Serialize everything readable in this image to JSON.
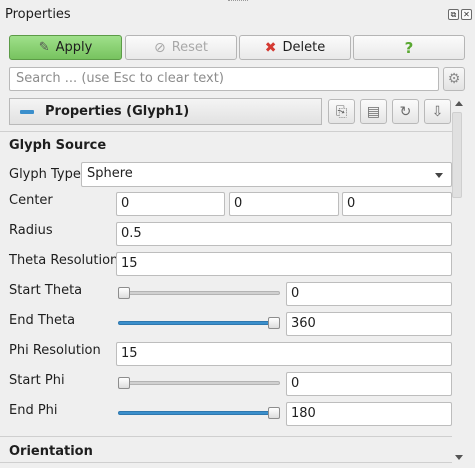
{
  "window": {
    "title": "Properties"
  },
  "toolbar": {
    "apply_label": "Apply",
    "reset_label": "Reset",
    "delete_label": "Delete",
    "help_label": "?"
  },
  "search": {
    "placeholder": "Search ... (use Esc to clear text)"
  },
  "panel": {
    "title": "Properties (Glyph1)"
  },
  "glyph_source": {
    "section_title": "Glyph Source",
    "glyph_type_label": "Glyph Type",
    "glyph_type_value": "Sphere",
    "center_label": "Center",
    "center_values": [
      "0",
      "0",
      "0"
    ],
    "radius_label": "Radius",
    "radius_value": "0.5",
    "theta_resolution_label": "Theta Resolution",
    "theta_resolution_value": "15",
    "start_theta_label": "Start Theta",
    "start_theta_value": "0",
    "start_theta_level": 0.0,
    "end_theta_label": "End Theta",
    "end_theta_value": "360",
    "end_theta_level": 1.0,
    "phi_resolution_label": "Phi Resolution",
    "phi_resolution_value": "15",
    "start_phi_label": "Start Phi",
    "start_phi_value": "0",
    "start_phi_level": 0.0,
    "end_phi_label": "End Phi",
    "end_phi_value": "180",
    "end_phi_level": 1.0
  },
  "orientation": {
    "section_title": "Orientation"
  },
  "colors": {
    "accent": "#3b8fcc",
    "apply_green": "#86d06e",
    "delete_red": "#d43a32",
    "help_green": "#5aa832"
  },
  "icons": [
    "apply-icon",
    "reset-icon",
    "delete-icon",
    "help-icon",
    "gear-icon",
    "copy-icon",
    "paste-icon",
    "restore-icon",
    "save-default-icon"
  ]
}
